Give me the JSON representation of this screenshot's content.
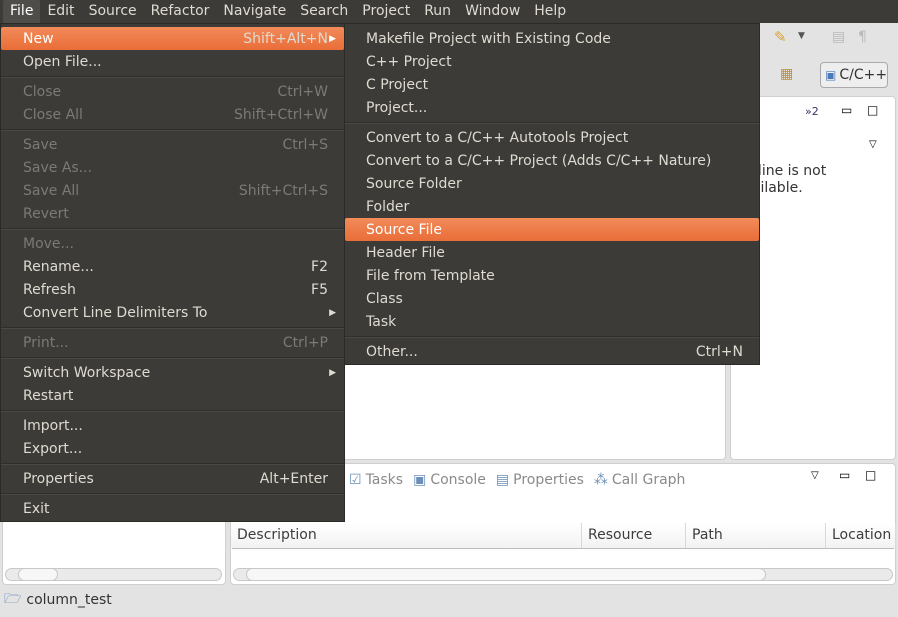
{
  "menubar": [
    "File",
    "Edit",
    "Source",
    "Refactor",
    "Navigate",
    "Search",
    "Project",
    "Run",
    "Window",
    "Help"
  ],
  "file_menu": [
    {
      "label": "New",
      "shortcut": "Shift+Alt+N",
      "submenu": true,
      "highlighted": true
    },
    {
      "label": "Open File..."
    },
    {
      "sep": true
    },
    {
      "label": "Close",
      "shortcut": "Ctrl+W",
      "disabled": true
    },
    {
      "label": "Close All",
      "shortcut": "Shift+Ctrl+W",
      "disabled": true
    },
    {
      "sep": true
    },
    {
      "label": "Save",
      "shortcut": "Ctrl+S",
      "disabled": true
    },
    {
      "label": "Save As...",
      "disabled": true
    },
    {
      "label": "Save All",
      "shortcut": "Shift+Ctrl+S",
      "disabled": true
    },
    {
      "label": "Revert",
      "disabled": true
    },
    {
      "sep": true
    },
    {
      "label": "Move...",
      "disabled": true
    },
    {
      "label": "Rename...",
      "shortcut": "F2"
    },
    {
      "label": "Refresh",
      "shortcut": "F5"
    },
    {
      "label": "Convert Line Delimiters To",
      "submenu": true
    },
    {
      "sep": true
    },
    {
      "label": "Print...",
      "shortcut": "Ctrl+P",
      "disabled": true
    },
    {
      "sep": true
    },
    {
      "label": "Switch Workspace",
      "submenu": true
    },
    {
      "label": "Restart"
    },
    {
      "sep": true
    },
    {
      "label": "Import..."
    },
    {
      "label": "Export..."
    },
    {
      "sep": true
    },
    {
      "label": "Properties",
      "shortcut": "Alt+Enter"
    },
    {
      "sep": true
    },
    {
      "label": "Exit"
    }
  ],
  "new_submenu": [
    {
      "label": "Makefile Project with Existing Code"
    },
    {
      "label": "C++ Project"
    },
    {
      "label": "C Project"
    },
    {
      "label": "Project..."
    },
    {
      "sep": true
    },
    {
      "label": "Convert to a C/C++ Autotools Project"
    },
    {
      "label": "Convert to a C/C++ Project (Adds C/C++ Nature)"
    },
    {
      "label": "Source Folder"
    },
    {
      "label": "Folder"
    },
    {
      "label": "Source File",
      "highlighted": true
    },
    {
      "label": "Header File"
    },
    {
      "label": "File from Template"
    },
    {
      "label": "Class"
    },
    {
      "label": "Task"
    },
    {
      "sep": true
    },
    {
      "label": "Other...",
      "shortcut": "Ctrl+N"
    }
  ],
  "toolbar": {
    "perspective": "C/C++"
  },
  "outline": {
    "overflow": "»2",
    "message": "outline is not available."
  },
  "bottom_tabs": [
    "Tasks",
    "Console",
    "Properties",
    "Call Graph"
  ],
  "table_headers": [
    "Description",
    "Resource",
    "Path",
    "Location"
  ],
  "status": {
    "project": "column_test"
  },
  "colors": {
    "highlight": "#e96d38",
    "menu_bg": "#3c3b37"
  }
}
